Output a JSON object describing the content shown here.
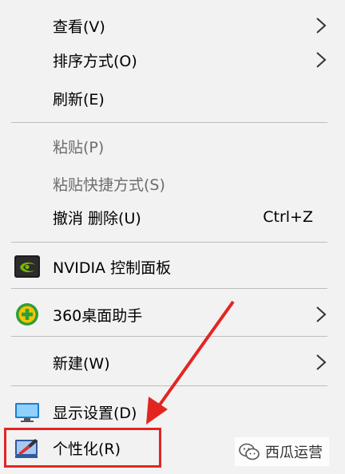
{
  "menu": {
    "view": {
      "label": "查看(V)"
    },
    "sort": {
      "label": "排序方式(O)"
    },
    "refresh": {
      "label": "刷新(E)"
    },
    "paste": {
      "label": "粘贴(P)"
    },
    "paste_shortcut": {
      "label": "粘贴快捷方式(S)"
    },
    "undo_delete": {
      "label": "撤消 删除(U)",
      "shortcut": "Ctrl+Z"
    },
    "nvidia": {
      "label": "NVIDIA 控制面板",
      "icon": "nvidia-icon"
    },
    "desktop360": {
      "label": "360桌面助手",
      "icon": "360-icon"
    },
    "new": {
      "label": "新建(W)"
    },
    "display_settings": {
      "label": "显示设置(D)",
      "icon": "monitor-icon"
    },
    "personalize": {
      "label": "个性化(R)",
      "icon": "personalize-icon"
    }
  },
  "annotation": {
    "color": "#e32521"
  },
  "watermark": {
    "text": "西瓜运营",
    "icon": "wechat-icon"
  }
}
